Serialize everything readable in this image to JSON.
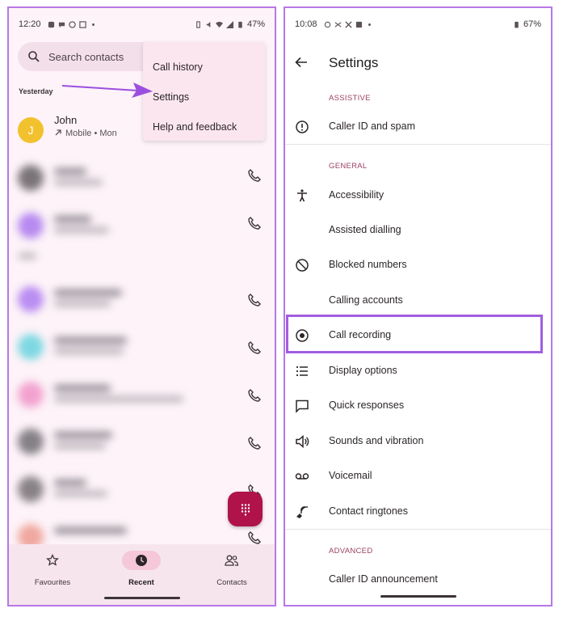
{
  "left": {
    "status": {
      "time": "12:20",
      "battery": "47%"
    },
    "search": {
      "placeholder": "Search contacts"
    },
    "sections": {
      "yesterday": "Yesterday"
    },
    "contact": {
      "initial": "J",
      "name": "John",
      "detail": "Mobile • Mon"
    },
    "overflow_menu": [
      "Call history",
      "Settings",
      "Help and feedback"
    ],
    "nav": [
      {
        "label": "Favourites",
        "icon": "star-icon"
      },
      {
        "label": "Recent",
        "icon": "clock-icon",
        "active": true
      },
      {
        "label": "Contacts",
        "icon": "people-icon"
      }
    ],
    "colors": {
      "fab": "#b0124a",
      "arrow": "#9b4fe0",
      "frame": "#b678e6"
    }
  },
  "right": {
    "status": {
      "time": "10:08",
      "battery": "67%"
    },
    "title": "Settings",
    "sections": [
      {
        "header": "ASSISTIVE",
        "items": [
          {
            "label": "Caller ID and spam",
            "icon": "info-icon"
          }
        ]
      },
      {
        "header": "GENERAL",
        "items": [
          {
            "label": "Accessibility",
            "icon": "accessibility-icon"
          },
          {
            "label": "Assisted dialling",
            "icon": ""
          },
          {
            "label": "Blocked numbers",
            "icon": "block-icon"
          },
          {
            "label": "Calling accounts",
            "icon": ""
          },
          {
            "label": "Call recording",
            "icon": "record-icon",
            "highlighted": true
          },
          {
            "label": "Display options",
            "icon": "list-icon"
          },
          {
            "label": "Quick responses",
            "icon": "message-icon"
          },
          {
            "label": "Sounds and vibration",
            "icon": "volume-icon"
          },
          {
            "label": "Voicemail",
            "icon": "voicemail-icon"
          },
          {
            "label": "Contact ringtones",
            "icon": "ringtone-icon"
          }
        ]
      },
      {
        "header": "ADVANCED",
        "items": [
          {
            "label": "Caller ID announcement",
            "icon": ""
          }
        ]
      }
    ],
    "colors": {
      "section_header": "#9c4064",
      "highlight": "#a15ee0"
    }
  }
}
